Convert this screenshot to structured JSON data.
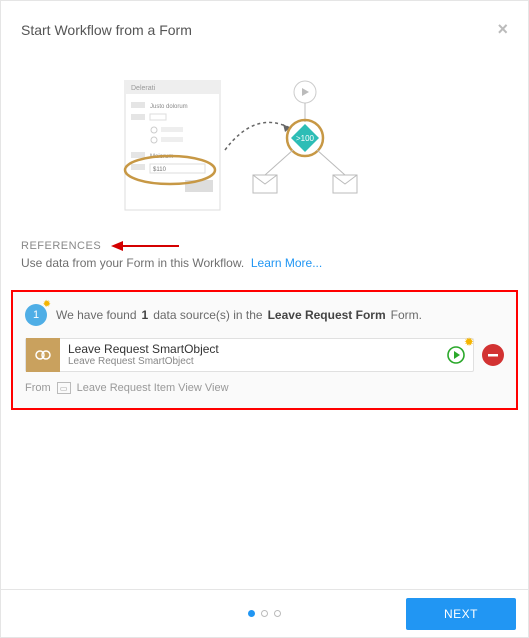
{
  "header": {
    "title": "Start Workflow from a Form"
  },
  "references": {
    "title": "REFERENCES",
    "description": "Use data from your Form in this Workflow.",
    "learn_more": "Learn More..."
  },
  "sources": {
    "step": "1",
    "found_prefix": "We have found",
    "found_count": "1",
    "found_mid": "data source(s) in the",
    "form_name": "Leave Request Form",
    "found_suffix": "Form.",
    "items": [
      {
        "name": "Leave Request SmartObject",
        "sub": "Leave Request SmartObject"
      }
    ],
    "from_label": "From",
    "from_view": "Leave Request Item View View"
  },
  "footer": {
    "next": "NEXT",
    "active_dot": 0,
    "dot_count": 3
  },
  "illustration": {
    "flow_value": ">100",
    "form_title": "Delerati",
    "field_a": "Justo dolorum",
    "field_b": "Maiorum",
    "field_c": "$110"
  }
}
